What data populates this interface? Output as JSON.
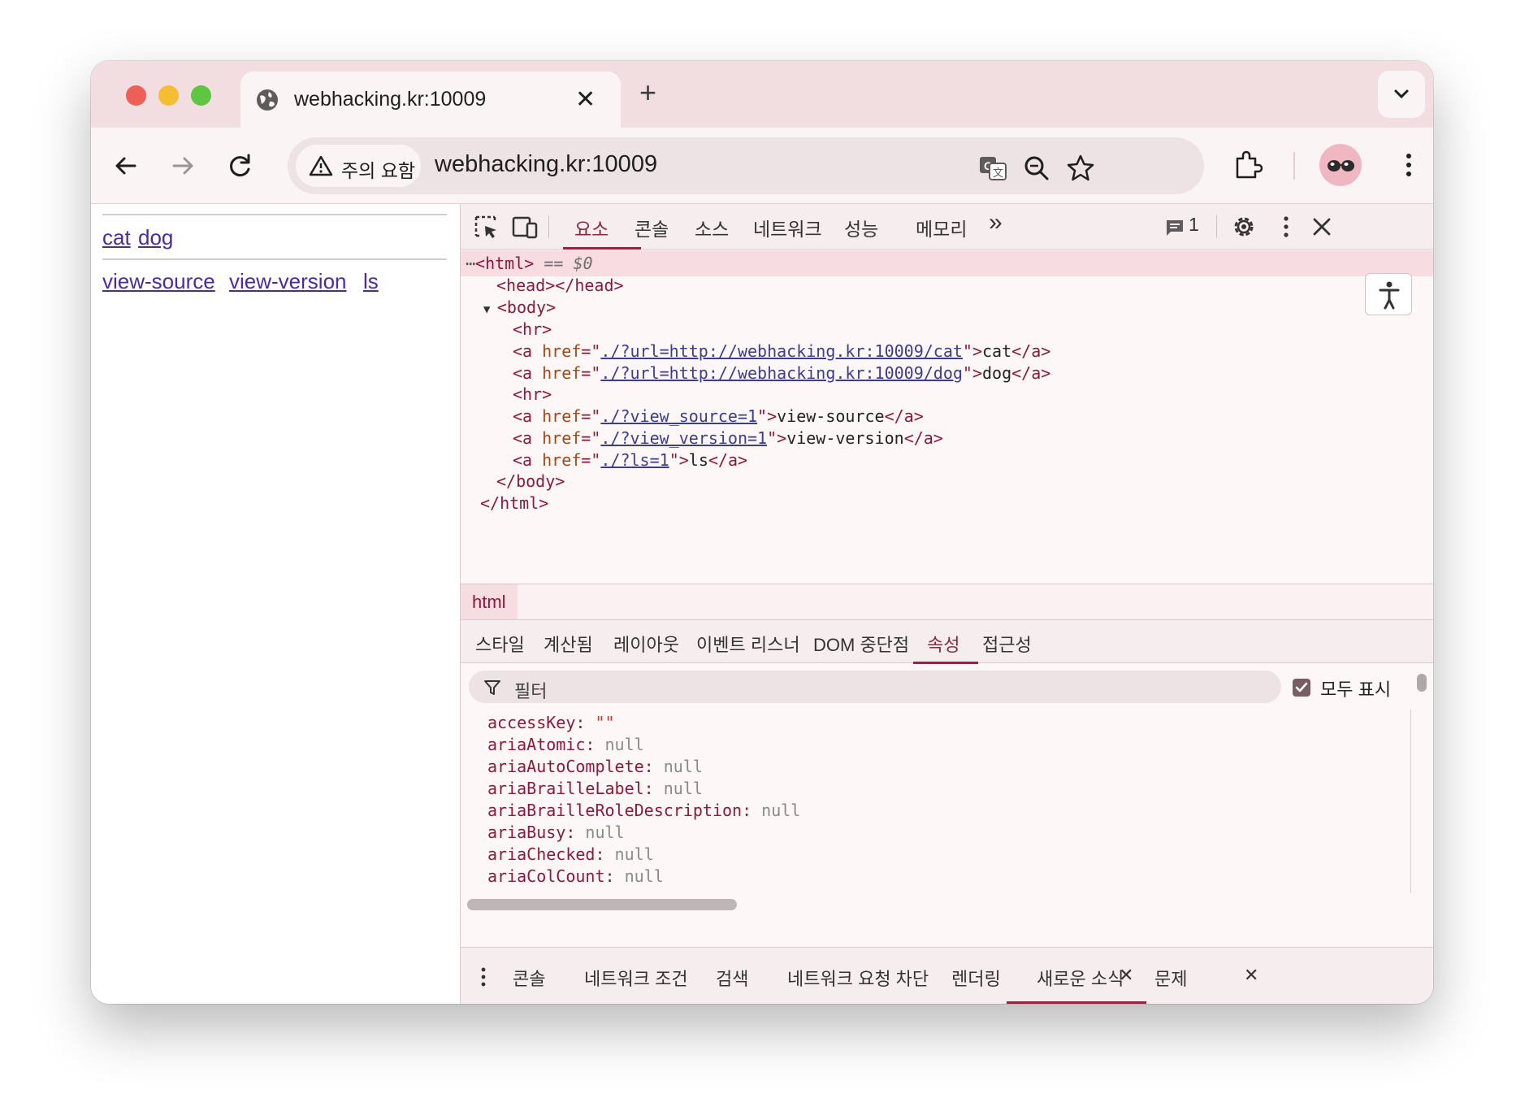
{
  "browser": {
    "tab_title": "webhacking.kr:10009",
    "tab_close": "✕",
    "new_tab": "+",
    "security_chip": "주의 요함",
    "url": "webhacking.kr:10009"
  },
  "page": {
    "links_row1": [
      "cat",
      "dog"
    ],
    "links_row2": [
      "view-source",
      "view-version",
      "ls"
    ]
  },
  "devtools": {
    "tabs": [
      "요소",
      "콘솔",
      "소스",
      "네트워크",
      "성능",
      "메모리"
    ],
    "more_tabs": "»",
    "issues_count": "1",
    "dom": {
      "line0_tag": "<html>",
      "line0_eq": " == ",
      "line0_ref": "$0",
      "line1": "<head></head>",
      "line2": "<body>",
      "line3": "<hr>",
      "a1_href": "./?url=http://webhacking.kr:10009/cat",
      "a1_text": "cat",
      "a2_href": "./?url=http://webhacking.kr:10009/dog",
      "a2_text": "dog",
      "line6": "<hr>",
      "a3_href": "./?view_source=1",
      "a3_text": "view-source",
      "a4_href": "./?view_version=1",
      "a4_text": "view-version",
      "a5_href": "./?ls=1",
      "a5_text": "ls",
      "line10": "</body>",
      "line11": "</html>"
    },
    "breadcrumb": "html",
    "subtabs": [
      "스타일",
      "계산됨",
      "레이아웃",
      "이벤트 리스너",
      "DOM 중단점",
      "속성",
      "접근성"
    ],
    "filter_placeholder": "필터",
    "show_all_label": "모두 표시",
    "properties": [
      {
        "key": "accessKey",
        "value": "\"\""
      },
      {
        "key": "ariaAtomic",
        "value": "null"
      },
      {
        "key": "ariaAutoComplete",
        "value": "null"
      },
      {
        "key": "ariaBrailleLabel",
        "value": "null"
      },
      {
        "key": "ariaBrailleRoleDescription",
        "value": "null"
      },
      {
        "key": "ariaBusy",
        "value": "null"
      },
      {
        "key": "ariaChecked",
        "value": "null"
      },
      {
        "key": "ariaColCount",
        "value": "null"
      }
    ],
    "drawer_tabs": [
      "콘솔",
      "네트워크 조건",
      "검색",
      "네트워크 요청 차단",
      "렌더링",
      "새로운 소식",
      "문제"
    ],
    "drawer_tab_close": "✕",
    "drawer_close": "✕"
  },
  "colors": {
    "tabstrip": "#f2dde1",
    "accent": "#8b2942",
    "link": "#4b2aa6"
  }
}
